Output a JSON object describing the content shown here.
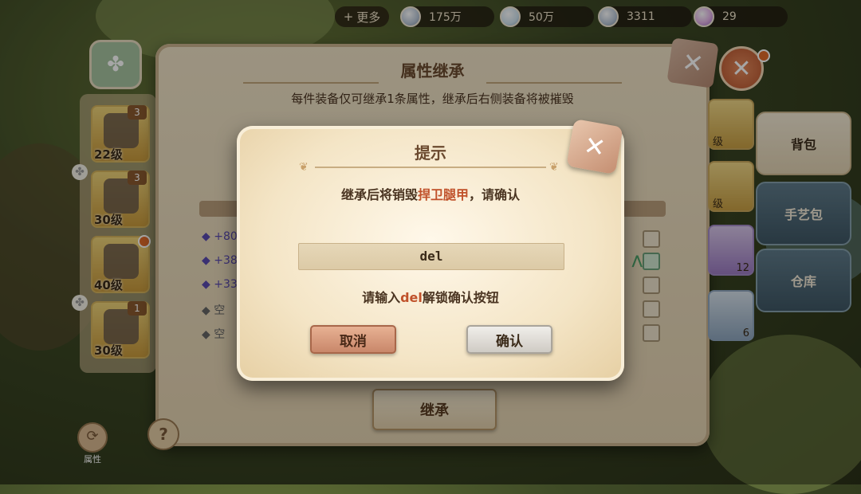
{
  "topbar": {
    "more_label": "更多",
    "resources": [
      {
        "icon": "crystal-icon",
        "value": "175万"
      },
      {
        "icon": "clover-coin-icon",
        "value": "50万"
      },
      {
        "icon": "gem-icon",
        "value": "3311"
      },
      {
        "icon": "potion-icon",
        "value": "29"
      }
    ]
  },
  "panel": {
    "title": "属性继承",
    "subtitle": "每件装备仅可继承1条属性，继承后右侧装备将被摧毁",
    "attributes": [
      "+80",
      "+38",
      "+33",
      "空",
      "空"
    ],
    "inherit_button": "继承",
    "help_icon": "?"
  },
  "left_items": [
    {
      "level": "22级",
      "count": "3"
    },
    {
      "level": "30级",
      "count": "3"
    },
    {
      "level": "40级",
      "count": ""
    },
    {
      "level": "30级",
      "count": "1"
    }
  ],
  "left_tab": {
    "label": "属性"
  },
  "right_items": [
    {
      "label": "级"
    },
    {
      "label": "级"
    },
    {
      "label": "12"
    },
    {
      "label": "6"
    }
  ],
  "side_tabs": [
    "背包",
    "手艺包",
    "仓库"
  ],
  "dialog": {
    "title": "提示",
    "message_prefix": "继承后将销毁",
    "message_item": "捍卫腿甲",
    "message_suffix": "，请确认",
    "input_value": "del",
    "hint_prefix": "请输入",
    "hint_keyword": "del",
    "hint_suffix": "解锁确认按钮",
    "cancel_label": "取消",
    "confirm_label": "确认"
  },
  "colors": {
    "highlight": "#c0512a",
    "dialog_bg": "#f4e5c6",
    "panel_bg": "#efe2c6"
  }
}
